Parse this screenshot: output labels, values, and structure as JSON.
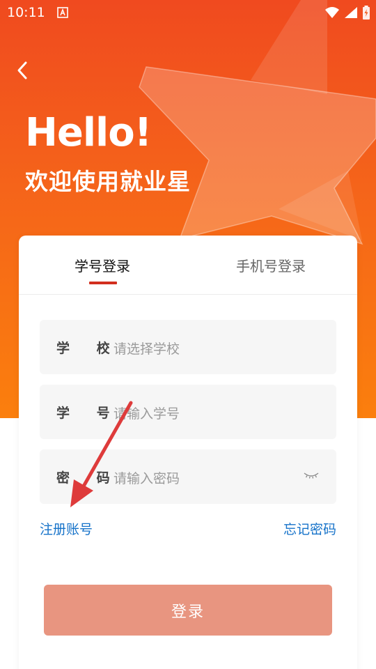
{
  "status_bar": {
    "time": "10:11"
  },
  "hero": {
    "greeting": "Hello!",
    "subtitle": "欢迎使用就业星"
  },
  "tabs": {
    "student_login": "学号登录",
    "phone_login": "手机号登录"
  },
  "form": {
    "school_label": "学 校",
    "school_placeholder": "请选择学校",
    "id_label": "学 号",
    "id_placeholder": "请输入学号",
    "password_label": "密 码",
    "password_placeholder": "请输入密码"
  },
  "links": {
    "register": "注册账号",
    "forgot": "忘记密码"
  },
  "login_button": "登录",
  "colors": {
    "hero_top": "#f04a1f",
    "hero_bottom": "#fb7f0d",
    "tab_indicator": "#d22f1e",
    "link": "#1572c9",
    "login_button": "#e89580",
    "annotation_arrow": "#de3b3b"
  },
  "icons": {
    "back": "chevron-left-icon",
    "wifi": "wifi-icon",
    "signal": "signal-icon",
    "battery": "battery-charging-icon",
    "eye": "eye-closed-icon",
    "app": "notification-app-icon"
  }
}
